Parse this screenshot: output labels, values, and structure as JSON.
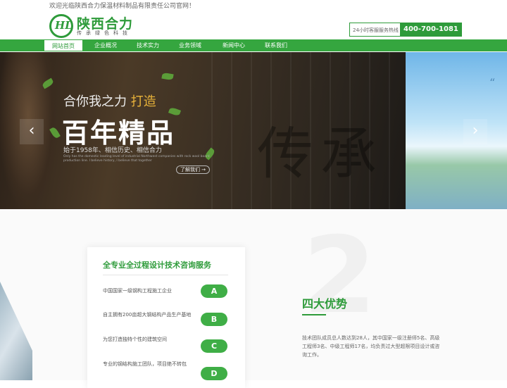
{
  "topbar": {
    "welcome": "欢迎光临陕西合力保温材料制品有限责任公司官网！"
  },
  "logo": {
    "mark": "HL",
    "name": "陕西合力",
    "tagline": "传承绿色科技"
  },
  "hotline": {
    "label": "24小时客服服务热线",
    "number": "400-700-1081"
  },
  "nav": {
    "items": [
      {
        "label": "网站首页",
        "active": true
      },
      {
        "label": "企业概况"
      },
      {
        "label": "技术实力"
      },
      {
        "label": "业务领域"
      },
      {
        "label": "新闻中心"
      },
      {
        "label": "联系我们"
      }
    ]
  },
  "banner": {
    "slogan_pre": "合你我之力",
    "slogan_gold": "打造",
    "headline": "百年精品",
    "line3": "始于1958年、相信历史、相信合力",
    "line4": "Only has the domestic leading level of industrial Northwest companies with rock wool board production line. I believe history, I believe that together",
    "more": "了解我们",
    "brush_text": "传承",
    "prev": "‹",
    "next": "›",
    "quote": "“"
  },
  "services": {
    "title": "全专业全过程设计技术咨询服务",
    "rows": [
      {
        "text": "中国国家一级钢构工程施工企业",
        "badge": "A"
      },
      {
        "text": "自主拥有200亩超大钢结构产品生产基地",
        "badge": "B"
      },
      {
        "text": "为您打造独特个性的建筑空间",
        "badge": "C"
      },
      {
        "text": "专业的钢结构施工团队，项目绝不转包",
        "badge": "D"
      }
    ]
  },
  "advantages": {
    "bg_number": "2",
    "title": "四大优势",
    "desc": "技术团队成员总人数达到28人，其中国家一级注册师5名、高级工程师3名、中级工程师17名，均负责过大型超限项目设计或咨询工作。"
  },
  "colors": {
    "brand_green": "#2e9b3a",
    "nav_green": "#35a63f",
    "badge_green": "#3fae46"
  }
}
